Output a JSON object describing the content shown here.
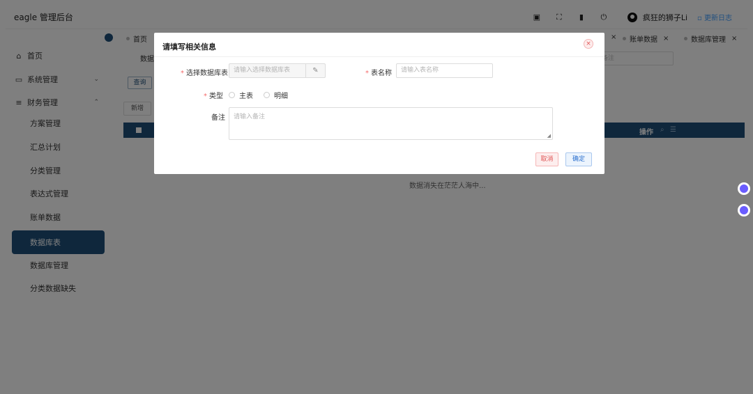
{
  "header": {
    "brand": "eagle 管理后台",
    "user_name": "疯狂的狮子Li",
    "update_log": "更新日志",
    "icons": [
      "screenshot-icon",
      "fullscreen-icon",
      "trash-icon",
      "power-icon"
    ]
  },
  "sidebar": {
    "items": [
      {
        "label": "首页",
        "icon": "home-icon",
        "glyph": "⌂"
      },
      {
        "label": "系统管理",
        "icon": "monitor-icon",
        "glyph": "▭",
        "arrow": "⌄"
      },
      {
        "label": "财务管理",
        "icon": "database-icon",
        "glyph": "≡",
        "arrow": "⌃"
      }
    ],
    "sub_items": [
      "方案管理",
      "汇总计划",
      "分类管理",
      "表达式管理",
      "账单数据",
      "数据库表",
      "数据库管理",
      "分类数据缺失"
    ],
    "active_label": "数据库表"
  },
  "tabs": [
    {
      "label": "首页"
    },
    {
      "label": "账单数据"
    },
    {
      "label": "数据库管理"
    }
  ],
  "toolbar": {
    "search_label": "数据",
    "note_placeholder": "备注",
    "query_label": "查询",
    "add_label": "新增"
  },
  "table": {
    "op_label": "操作",
    "empty_text": "数据消失在茫茫人海中..."
  },
  "modal": {
    "title": "请填写相关信息",
    "close_glyph": "×",
    "db_label": "选择数据库表",
    "db_placeholder": "请输入选择数据库表",
    "table_name_label": "表名称",
    "table_name_placeholder": "请输入表名称",
    "type_label": "类型",
    "type_options": [
      "主表",
      "明细"
    ],
    "note_label": "备注",
    "note_placeholder": "请输入备注",
    "cancel_label": "取消",
    "ok_label": "确定"
  }
}
